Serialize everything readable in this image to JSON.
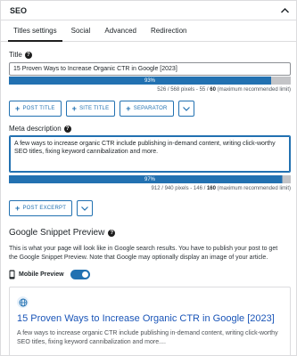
{
  "panel": {
    "title": "SEO"
  },
  "tabs": [
    {
      "label": "Titles settings",
      "active": true
    },
    {
      "label": "Social"
    },
    {
      "label": "Advanced"
    },
    {
      "label": "Redirection"
    }
  ],
  "title_field": {
    "label": "Title",
    "value": "15 Proven Ways to Increase Organic CTR in Google [2023]",
    "progress_percent": 93,
    "progress_label": "93%",
    "pixels_used": "526",
    "pixels_max": "568",
    "chars_used": "55",
    "chars_max": "60",
    "limit_note": "(maximum recommended limit)",
    "buttons": [
      "POST TITLE",
      "SITE TITLE",
      "SEPARATOR"
    ]
  },
  "meta_field": {
    "label": "Meta description",
    "value": "A few ways to increase organic CTR include publishing in-demand content, writing click-worthy SEO titles, fixing keyword cannibalization and more.",
    "progress_percent": 97,
    "progress_label": "97%",
    "pixels_used": "912",
    "pixels_max": "940",
    "chars_used": "146",
    "chars_max": "160",
    "limit_note": "(maximum recommended limit)",
    "buttons": [
      "POST EXCERPT"
    ]
  },
  "snippet": {
    "heading": "Google Snippet Preview",
    "description": "This is what your page will look like in Google search results. You have to publish your post to get the Google Snippet Preview. Note that Google may optionally display an image of your article.",
    "mobile_label": "Mobile Preview",
    "mobile_on": true,
    "preview_title": "15 Proven Ways to Increase Organic CTR in Google [2023]",
    "preview_desc": "A few ways to increase organic CTR include publishing in-demand content, writing click-worthy SEO titles, fixing keyword cannibalization and more...."
  },
  "colors": {
    "accent": "#2271b1",
    "link": "#1a55b8",
    "border": "#dcdcde"
  }
}
